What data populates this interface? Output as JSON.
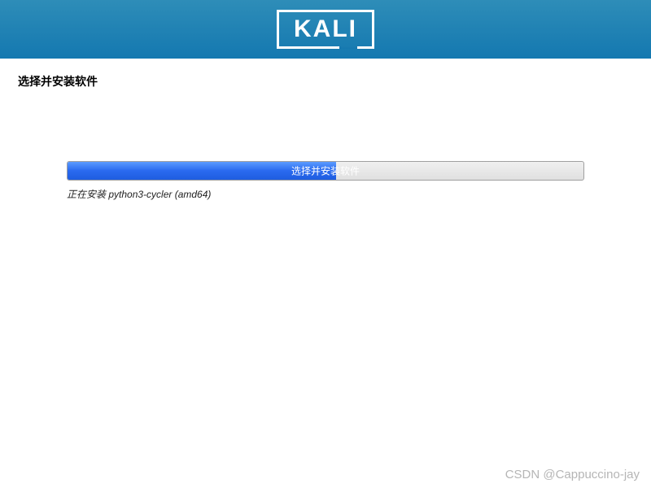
{
  "header": {
    "logo_text": "KALI"
  },
  "page": {
    "title": "选择并安装软件"
  },
  "progress": {
    "label": "选择并安装软件",
    "percent": 52,
    "status": "正在安装 python3-cycler (amd64)"
  },
  "watermark": {
    "text": "CSDN @Cappuccino-jay"
  }
}
